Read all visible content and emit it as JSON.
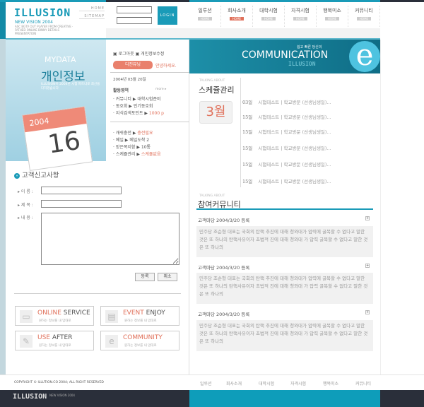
{
  "header": {
    "logo": "ILLUSION",
    "tagline": "NEW VISION 2004",
    "subtag": "ASC BGTV OUT PLAYER FROM CREATIVE · FATHED ONLINE BINNY DETAILS PRESENTATION",
    "home": "HOME",
    "sitemap": "SITEMAP",
    "login_label": "LOGIN",
    "nav": [
      {
        "label": "일루션",
        "sub": "HOME",
        "active": false
      },
      {
        "label": "회사소개",
        "sub": "HOME",
        "active": true
      },
      {
        "label": "대학시험",
        "sub": "HOME",
        "active": false
      },
      {
        "label": "자격시험",
        "sub": "HOME",
        "active": false
      },
      {
        "label": "행복미소",
        "sub": "HOME",
        "active": false
      },
      {
        "label": "커뮤니티",
        "sub": "HOME",
        "active": false
      }
    ]
  },
  "mydata": {
    "title_en": "MYDATA",
    "title_ko": "개인정보",
    "desc": "ILLUSION이 2004년 시험 파트너로 최선을 다하겠습니다",
    "cal_year": "2004",
    "cal_day": "16"
  },
  "user": {
    "logout": "로그아웃",
    "edit": "개인정보수정",
    "name": "디진뷰닝",
    "greeting": "안녕하세요.",
    "date": "2004년 03월 20일",
    "activity": "활동영역",
    "more": "more ▸",
    "items": [
      {
        "k": "커뮤니티",
        "v": "대학시험준비",
        "hl": false
      },
      {
        "k": "동호회",
        "v": "인기동호회",
        "hl": false
      },
      {
        "k": "지식검색포인트",
        "v": "1000 p",
        "hl": true
      }
    ],
    "items2": [
      {
        "k": "캐쉬충전",
        "v": "충전필요",
        "hl": true
      },
      {
        "k": "메일",
        "v": "메일도착 2",
        "hl": false
      },
      {
        "k": "받은쪽지함",
        "v": "10통",
        "hl": false
      },
      {
        "k": "스케쥴관리",
        "v": "스케쥴없음",
        "hl": true
      }
    ]
  },
  "banner": {
    "small": "쉽고 빠른 당신의",
    "title": "COMMUNICATION",
    "sub": "ILLUSION"
  },
  "schedule": {
    "talking": "TALKING ABOUT",
    "title": "스케쥴관리",
    "month": "3월",
    "rows": [
      {
        "d": "03일",
        "t": "시험테스트 | 학교방문 (선생님생일)..."
      },
      {
        "d": "15일",
        "t": "시험테스트 | 학교방문 (선생님생일)..."
      },
      {
        "d": "15일",
        "t": "시험테스트 | 학교방문 (선생님생일)..."
      },
      {
        "d": "15일",
        "t": "시험테스트 | 학교방문 (선생님생일)..."
      },
      {
        "d": "15일",
        "t": "시험테스트 | 학교방문 (선생님생일)..."
      },
      {
        "d": "15일",
        "t": "시험테스트 | 학교방문 (선생님생일)..."
      }
    ]
  },
  "community": {
    "talking": "TALKING ABOUT",
    "title": "참여커뮤니티",
    "expand": "+",
    "posts": [
      {
        "title": "고객마당 2004/3/20 등록",
        "body": "민주당 조순형 대표는 국회의 탄핵 추진에 대해 청와대가 압력에 굴복할 수 없다고 말한 것은 또 하나의 탄핵사유이자 초법적 진에 대해 청와대 가 압력 굴복할 수 없다고 말한 것은 또 하나의"
      },
      {
        "title": "고객마당 2004/3/20 등록",
        "body": "민주당 조순형 대표는 국회의 탄핵 추진에 대해 청와대가 압력에 굴복할 수 없다고 말한 것은 또 하나의 탄핵사유이자 초법적 진에 대해 청와대 가 압력 굴복할 수 없다고 말한 것은 또 하나의"
      },
      {
        "title": "고객마당 2004/3/20 등록",
        "body": "민주당 조순형 대표는 국회의 탄핵 추진에 대해 청와대가 압력에 굴복할 수 없다고 말한 것은 또 하나의 탄핵사유이자 초법적 진에 대해 청와대 가 압력 굴복할 수 없다고 말한 것은 또 하나의"
      }
    ]
  },
  "form": {
    "title": "고객신고사항",
    "name_label": "이 름 :",
    "subject_label": "제 목 :",
    "content_label": "내 용 :",
    "submit": "등록",
    "cancel": "취소"
  },
  "services": [
    {
      "a": "ONLINE",
      "b": "SERVICE",
      "sub": "원하는 정보를 내 맘대로",
      "icon": "monitor-icon"
    },
    {
      "a": "EVENT",
      "b": "ENJOY",
      "sub": "원하는 정보를 내 맘대로",
      "icon": "printer-icon"
    },
    {
      "a": "USE",
      "b": "AFTER",
      "sub": "원하는 정보를 내 맘대로",
      "icon": "pen-icon"
    },
    {
      "a": "COMMUNITY",
      "b": "",
      "sub": "원하는 정보를 내 맘대로",
      "icon": "ie-icon"
    }
  ],
  "footer": {
    "copyright": "COPYRIGHT © ILLUTION.CO 2004; ALL RIGHT RESERVED",
    "links": [
      "일루션",
      "회사소개",
      "대학시험",
      "자격시험",
      "행복미소",
      "커뮤니티"
    ],
    "logo": "ILLUSION",
    "tagline": "NEW VISION 2004"
  },
  "colors": {
    "accent": "#1a9bb8",
    "highlight": "#e0705a",
    "dark": "#2a2f3a"
  }
}
